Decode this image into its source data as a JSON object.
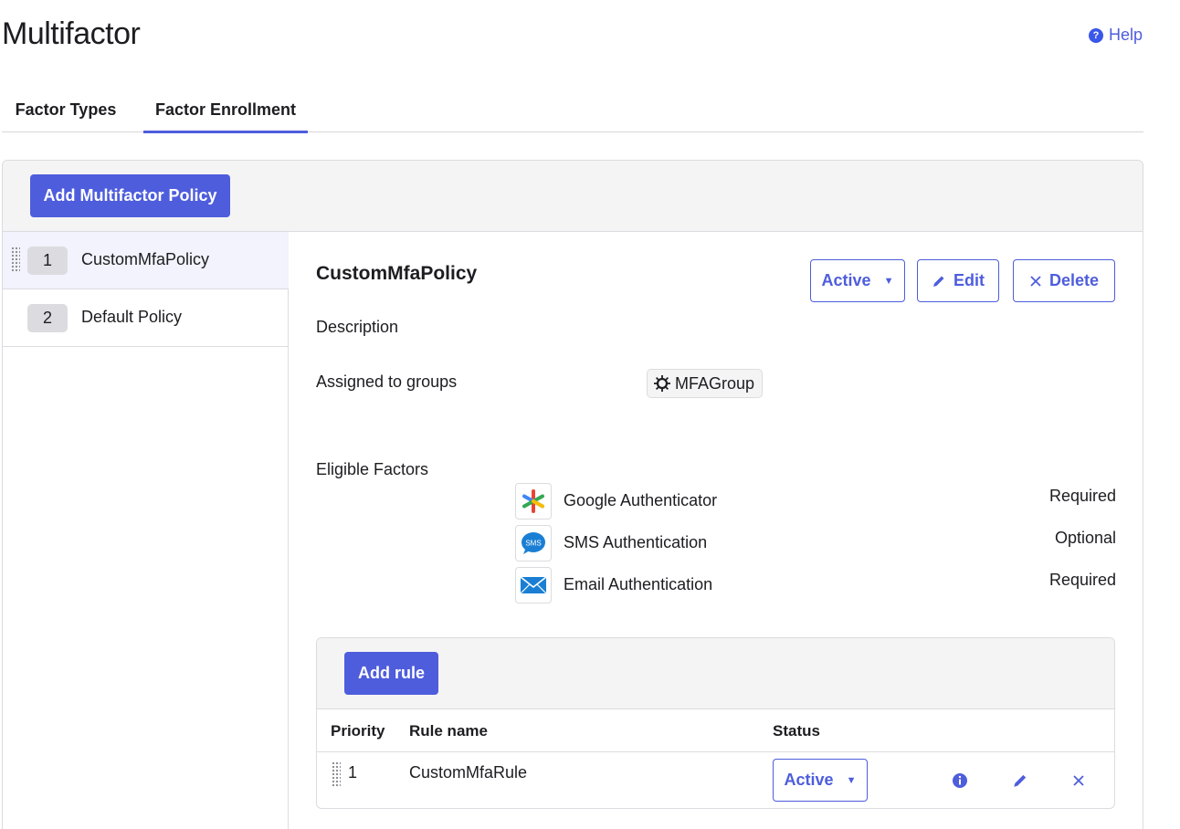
{
  "page": {
    "title": "Multifactor",
    "help_label": "Help"
  },
  "tabs": [
    {
      "label": "Factor Types",
      "active": false
    },
    {
      "label": "Factor Enrollment",
      "active": true
    }
  ],
  "toolbar": {
    "add_policy_label": "Add Multifactor Policy"
  },
  "policies": [
    {
      "priority": "1",
      "name": "CustomMfaPolicy",
      "selected": true
    },
    {
      "priority": "2",
      "name": "Default Policy",
      "selected": false
    }
  ],
  "detail": {
    "title": "CustomMfaPolicy",
    "status_label": "Active",
    "edit_label": "Edit",
    "delete_label": "Delete",
    "description_label": "Description",
    "groups_label": "Assigned to groups",
    "group_name": "MFAGroup",
    "factors_label": "Eligible Factors",
    "factors": [
      {
        "name": "Google Authenticator",
        "requirement": "Required",
        "icon": "google-authenticator-icon"
      },
      {
        "name": "SMS Authentication",
        "requirement": "Optional",
        "icon": "sms-icon",
        "icon_text": "SMS"
      },
      {
        "name": "Email Authentication",
        "requirement": "Required",
        "icon": "email-icon"
      }
    ]
  },
  "rules": {
    "add_label": "Add rule",
    "columns": {
      "priority": "Priority",
      "name": "Rule name",
      "status": "Status"
    },
    "rows": [
      {
        "priority": "1",
        "name": "CustomMfaRule",
        "status": "Active"
      }
    ]
  },
  "colors": {
    "accent": "#4e5ddc",
    "panel_bg": "#f4f4f5",
    "selected_bg": "#f2f3fc"
  }
}
